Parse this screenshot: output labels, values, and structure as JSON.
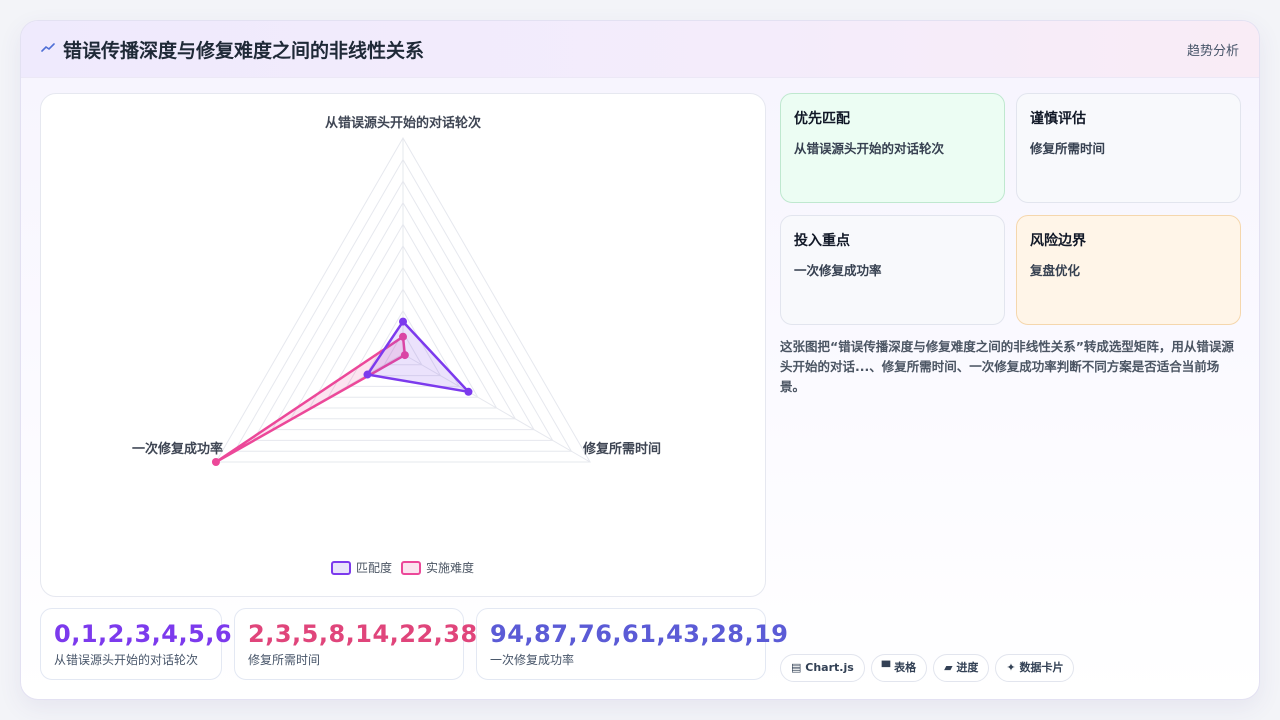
{
  "header": {
    "title": "错误传播深度与修复难度之间的非线性关系",
    "tag": "趋势分析",
    "icon": "trend-line-icon"
  },
  "chart_data": {
    "type": "radar",
    "axes": [
      "从错误源头开始的对话轮次",
      "修复所需时间",
      "一次修复成功率"
    ],
    "series": [
      {
        "name": "匹配度",
        "values": [
          15,
          35,
          19
        ],
        "color": "#7c3aed"
      },
      {
        "name": "实施难度",
        "values": [
          8,
          1,
          100
        ],
        "color": "#ec4899"
      }
    ],
    "range": [
      0,
      100
    ],
    "grid_levels": 10,
    "legend_position": "bottom"
  },
  "stats": [
    {
      "value": "0,1,2,3,4,5,6",
      "label": "从错误源头开始的对话轮次",
      "color": "#7c3aed"
    },
    {
      "value": "2,3,5,8,14,22,38",
      "label": "修复所需时间",
      "color": "#e0457b"
    },
    {
      "value": "94,87,76,61,43,28,19",
      "label": "一次修复成功率",
      "color": "#5b5bd6"
    }
  ],
  "quadrants": [
    {
      "title": "优先匹配",
      "sub": "从错误源头开始的对话轮次",
      "bg": "#ecfdf3",
      "border": "#bfe8cf"
    },
    {
      "title": "谨慎评估",
      "sub": "修复所需时间",
      "bg": "#f8f9fc",
      "border": "#e2e5ee"
    },
    {
      "title": "投入重点",
      "sub": "一次修复成功率",
      "bg": "#f8f9fc",
      "border": "#e2e5ee"
    },
    {
      "title": "风险边界",
      "sub": "复盘优化",
      "bg": "#fff5e8",
      "border": "#f5d7ad"
    }
  ],
  "description": "这张图把“错误传播深度与修复难度之间的非线性关系”转成选型矩阵，用从错误源头开始的对话...、修复所需时间、一次修复成功率判断不同方案是否适合当前场景。",
  "chips": [
    {
      "icon": "chart-icon",
      "glyph": "▤",
      "label": "Chart.js"
    },
    {
      "icon": "table-icon",
      "glyph": "▀",
      "label": "表格"
    },
    {
      "icon": "progress-icon",
      "glyph": "▰",
      "label": "进度"
    },
    {
      "icon": "sparkle-icon",
      "glyph": "✦",
      "label": "数据卡片"
    }
  ]
}
